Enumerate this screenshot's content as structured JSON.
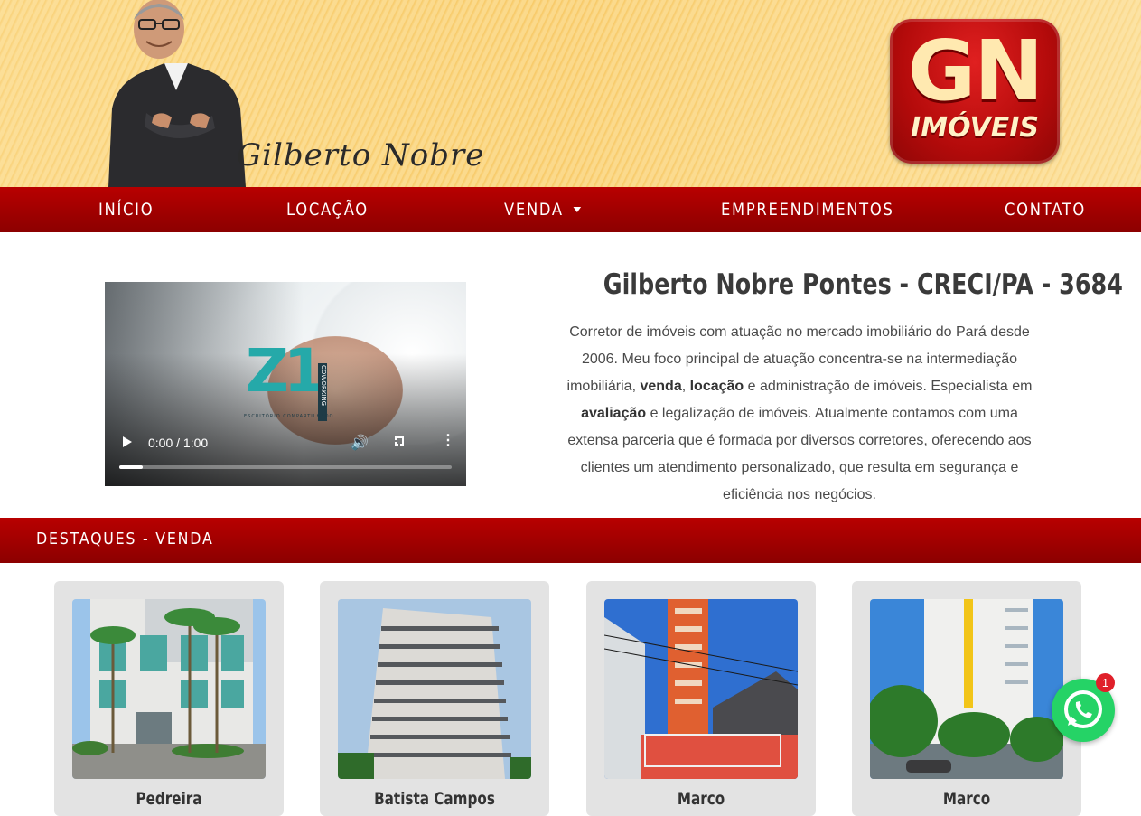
{
  "header": {
    "signature": "Gilberto Nobre",
    "logo": {
      "mark": "GN",
      "subtitle": "IMÓVEIS"
    }
  },
  "nav": {
    "items": [
      {
        "label": "INÍCIO"
      },
      {
        "label": "LOCAÇÃO"
      },
      {
        "label": "VENDA"
      },
      {
        "label": "EMPREENDIMENTOS"
      },
      {
        "label": "CONTATO"
      }
    ]
  },
  "video": {
    "time": "0:00 / 1:00",
    "progress": 0.07,
    "brand": "Z1",
    "brand_side": "COWORKING",
    "brand_tag": "ESCRITÓRIO COMPARTILHADO"
  },
  "intro": {
    "title": "Gilberto Nobre Pontes - CRECI/PA - 3684",
    "p1": "Corretor de imóveis com atuação no mercado imobiliário do Pará desde 2006. Meu foco principal de atuação concentra-se na intermediação imobiliária, ",
    "b1": "venda",
    "s1": ", ",
    "b2": "locação",
    "p2": " e administração de imóveis. Especialista em ",
    "b3": "avaliação",
    "p3": " e legalização de imóveis. Atualmente contamos com uma extensa parceria que é formada por diversos corretores, oferecendo aos clientes um atendimento personalizado, que resulta em segurança e eficiência nos negócios."
  },
  "highlights": {
    "title": "DESTAQUES - VENDA",
    "cards": [
      {
        "caption": "Pedreira"
      },
      {
        "caption": "Batista Campos"
      },
      {
        "caption": "Marco"
      },
      {
        "caption": "Marco"
      }
    ]
  },
  "whatsapp": {
    "badge": "1"
  },
  "colors": {
    "primary_red": "#a30000",
    "whatsapp_green": "#25d366",
    "banner_yellow": "#fbd98a"
  }
}
